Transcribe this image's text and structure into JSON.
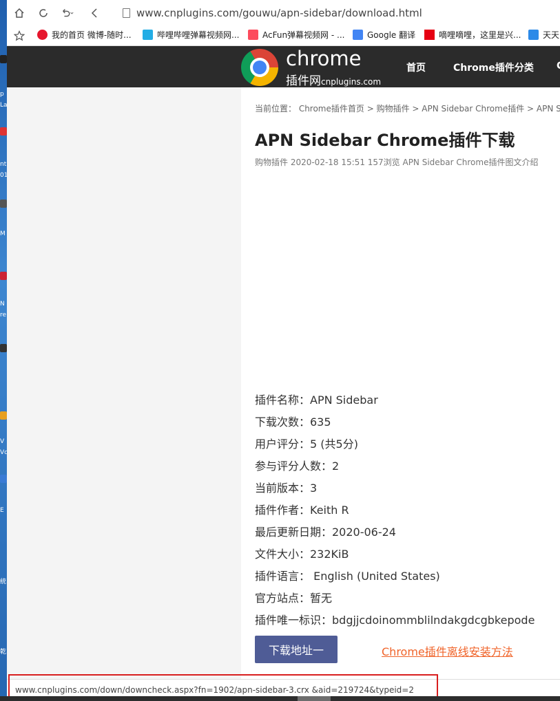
{
  "browser": {
    "url": "www.cnplugins.com/gouwu/apn-sidebar/download.html",
    "bookmarks": [
      {
        "label": "我的首页 微博-随时...",
        "color": "#e6162d"
      },
      {
        "label": "哔哩哔哩弹幕视频网...",
        "color": "#23ade5"
      },
      {
        "label": "AcFun弹幕视频网 - ...",
        "color": "#fd4c5d"
      },
      {
        "label": "Google 翻译",
        "color": "#4285f4"
      },
      {
        "label": "嘀哩嘀哩，这里是兴...",
        "color": "#e60012"
      },
      {
        "label": "天天",
        "color": "#2c8ae8"
      }
    ],
    "status_url": "www.cnplugins.com/down/downcheck.aspx?fn=1902/apn-sidebar-3.crx &aid=219724&typeid=2"
  },
  "site": {
    "logo_title": "chrome",
    "logo_sub": "插件网",
    "logo_domain": "cnplugins.com",
    "nav": [
      "首页",
      "Chrome插件分类",
      "C"
    ]
  },
  "page": {
    "breadcrumb": "当前位置： Chrome插件首页 > 购物插件 > APN Sidebar Chrome插件 > APN Sid",
    "title": "APN Sidebar Chrome插件下载",
    "meta": "购物插件 2020-02-18 15:51 157浏览 APN Sidebar Chrome插件图文介绍",
    "info": [
      "插件名称：APN Sidebar",
      "下载次数：635",
      "用户评分：5 (共5分)",
      "参与评分人数：2",
      "当前版本：3",
      "插件作者：Keith R",
      "最后更新日期：2020-06-24",
      "文件大小：232KiB",
      "插件语言： English (United States)",
      "官方站点：暂无",
      "插件唯一标识：bdgjjcdoinommblilndakgdcgbkepode"
    ],
    "download_button": "下载地址一",
    "install_link": "Chrome插件离线安装方法"
  },
  "desktop": {
    "fragments": [
      "p",
      "La",
      "nt",
      "01",
      "M",
      "N",
      "re",
      "V",
      "Vc",
      "E",
      "统",
      "乾"
    ]
  },
  "colors": {
    "header_bg": "#2b2b2b",
    "button_bg": "#4f5c96",
    "link": "#f0642a",
    "highlight": "#d81e1e"
  }
}
